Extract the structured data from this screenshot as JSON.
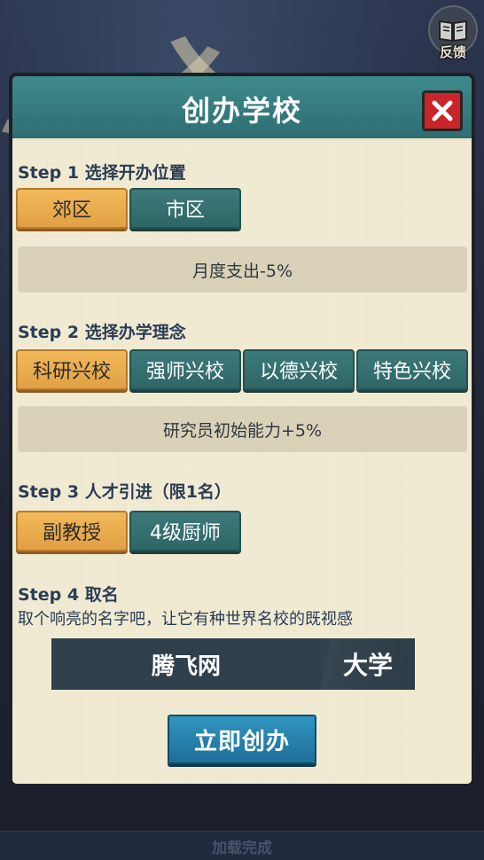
{
  "feedback": {
    "label": "反馈"
  },
  "loading_status": "加载完成",
  "dialog": {
    "title": "创办学校",
    "step1": {
      "title": "Step 1 选择开办位置",
      "options": [
        "郊区",
        "市区"
      ],
      "selected": "郊区",
      "effect": "月度支出-5%"
    },
    "step2": {
      "title": "Step 2 选择办学理念",
      "options": [
        "科研兴校",
        "强师兴校",
        "以德兴校",
        "特色兴校"
      ],
      "selected": "科研兴校",
      "effect": "研究员初始能力+5%"
    },
    "step3": {
      "title": "Step 3 人才引进（限1名）",
      "options": [
        "副教授",
        "4级厨师"
      ],
      "selected": "副教授"
    },
    "step4": {
      "title": "Step 4 取名",
      "hint": "取个响亮的名字吧，让它有种世界名校的既视感",
      "name_value": "腾飞网",
      "name_suffix": "大学"
    },
    "create_button": "立即创办"
  },
  "colors": {
    "title_bar": "#2e6e72",
    "selected_option": "#e1a043",
    "unselected_option": "#2f6667",
    "create_button": "#1f6f99",
    "close_button": "#c8242a"
  }
}
